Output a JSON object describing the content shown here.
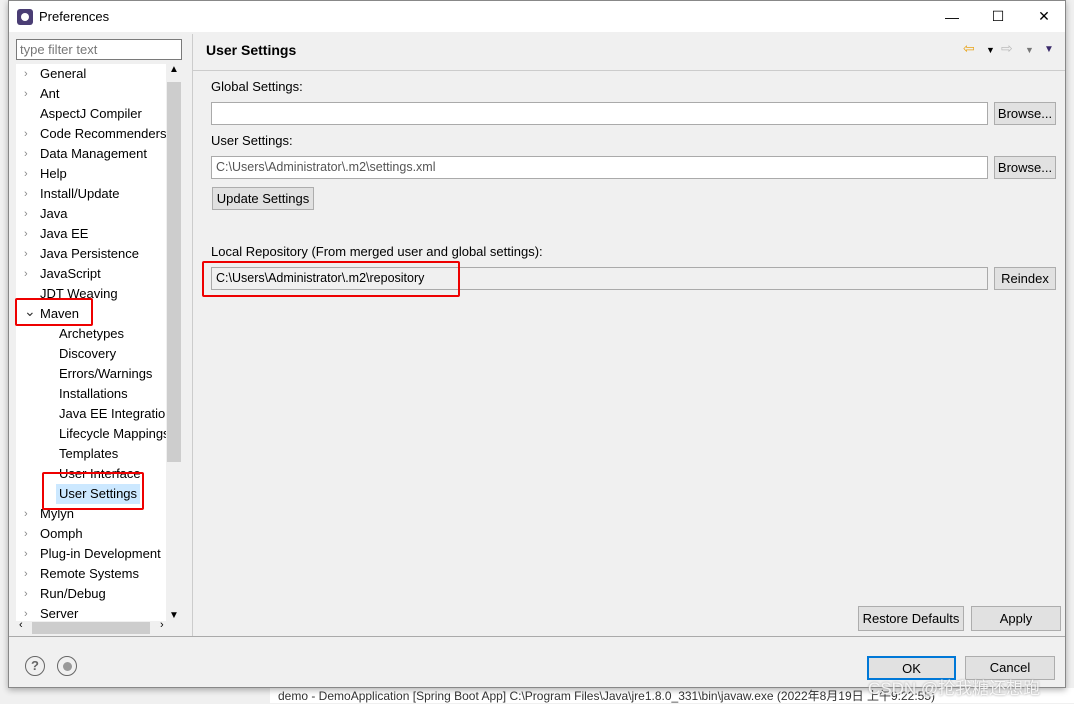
{
  "window": {
    "title": "Preferences",
    "minimize": "—",
    "maximize": "☐",
    "close": "✕"
  },
  "filter": {
    "placeholder": "type filter text",
    "value": ""
  },
  "tree": {
    "items": [
      {
        "label": "General",
        "level": 0
      },
      {
        "label": "Ant",
        "level": 0
      },
      {
        "label": "AspectJ Compiler",
        "level": 0,
        "leaf": true
      },
      {
        "label": "Code Recommenders",
        "level": 0
      },
      {
        "label": "Data Management",
        "level": 0
      },
      {
        "label": "Help",
        "level": 0
      },
      {
        "label": "Install/Update",
        "level": 0
      },
      {
        "label": "Java",
        "level": 0
      },
      {
        "label": "Java EE",
        "level": 0
      },
      {
        "label": "Java Persistence",
        "level": 0
      },
      {
        "label": "JavaScript",
        "level": 0
      },
      {
        "label": "JDT Weaving",
        "level": 0,
        "leaf": true
      },
      {
        "label": "Maven",
        "level": 0,
        "expanded": true
      },
      {
        "label": "Archetypes",
        "level": 1
      },
      {
        "label": "Discovery",
        "level": 1
      },
      {
        "label": "Errors/Warnings",
        "level": 1
      },
      {
        "label": "Installations",
        "level": 1
      },
      {
        "label": "Java EE Integration",
        "level": 1
      },
      {
        "label": "Lifecycle Mappings",
        "level": 1
      },
      {
        "label": "Templates",
        "level": 1
      },
      {
        "label": "User Interface",
        "level": 1
      },
      {
        "label": "User Settings",
        "level": 1,
        "selected": true
      },
      {
        "label": "Mylyn",
        "level": 0
      },
      {
        "label": "Oomph",
        "level": 0
      },
      {
        "label": "Plug-in Development",
        "level": 0
      },
      {
        "label": "Remote Systems",
        "level": 0
      },
      {
        "label": "Run/Debug",
        "level": 0
      },
      {
        "label": "Server",
        "level": 0
      }
    ]
  },
  "page": {
    "title": "User Settings",
    "global_label": "Global Settings:",
    "global_value": "",
    "browse1": "Browse...",
    "user_label": "User Settings:",
    "user_value": "C:\\Users\\Administrator\\.m2\\settings.xml",
    "browse2": "Browse...",
    "update": "Update Settings",
    "local_label": "Local Repository (From merged user and global settings):",
    "local_value": "C:\\Users\\Administrator\\.m2\\repository",
    "reindex": "Reindex",
    "restore": "Restore Defaults",
    "apply": "Apply"
  },
  "footer": {
    "ok": "OK",
    "cancel": "Cancel",
    "help_icon": "?"
  },
  "background": {
    "console": "demo - DemoApplication [Spring Boot App] C:\\Program Files\\Java\\jre1.8.0_331\\bin\\javaw.exe (2022年8月19日 上午9:22:55)"
  },
  "watermark": "CSDN @抢我糖还想跑",
  "colors": {
    "annotation": "#ee0000",
    "selection": "#cce8ff",
    "back_arrow": "#e8a317"
  }
}
